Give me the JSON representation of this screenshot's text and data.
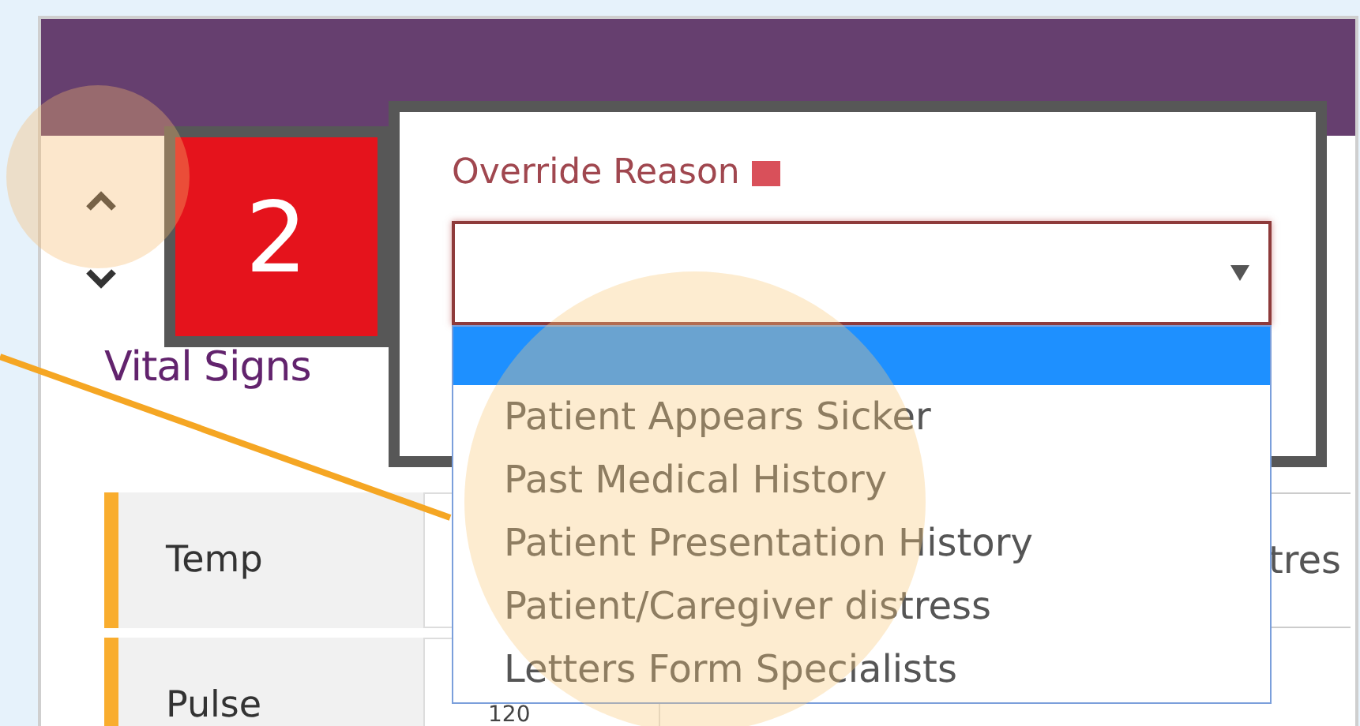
{
  "badge": {
    "text": "2"
  },
  "override_dialog": {
    "label": "Override Reason",
    "required": true,
    "select": {
      "open": true
    },
    "options": [
      {
        "highlighted": true
      },
      {
        "label": "Patient Appears Sicker",
        "highlighted": false
      },
      {
        "label": "Past Medical History",
        "highlighted": false
      },
      {
        "label": "Patient Presentation History",
        "highlighted": false
      },
      {
        "label": "Patient/Caregiver distress",
        "highlighted": false
      },
      {
        "label": "Letters Form Specialists",
        "highlighted": false
      }
    ]
  },
  "vital_signs": {
    "title": "Vital Signs",
    "rows": [
      {
        "label": "Temp",
        "value": null,
        "column_3": "tres"
      },
      {
        "label": "Pulse",
        "value": "120",
        "column_3": null
      }
    ]
  }
}
